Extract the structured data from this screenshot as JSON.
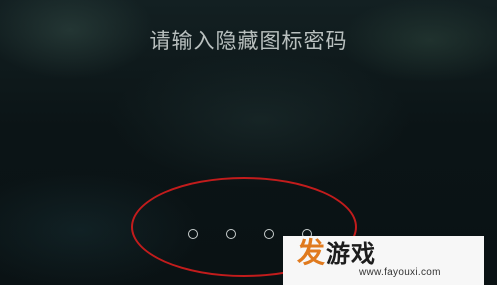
{
  "lock_screen": {
    "prompt": "请输入隐藏图标密码",
    "pin_dots_total": 4,
    "pin_dots_filled": 0
  },
  "annotation": {
    "color": "#c21c1c"
  },
  "watermark": {
    "logo_part1": "发",
    "logo_part2": "游戏",
    "url": "www.fayouxi.com",
    "logo_color": "#e07a1e"
  }
}
